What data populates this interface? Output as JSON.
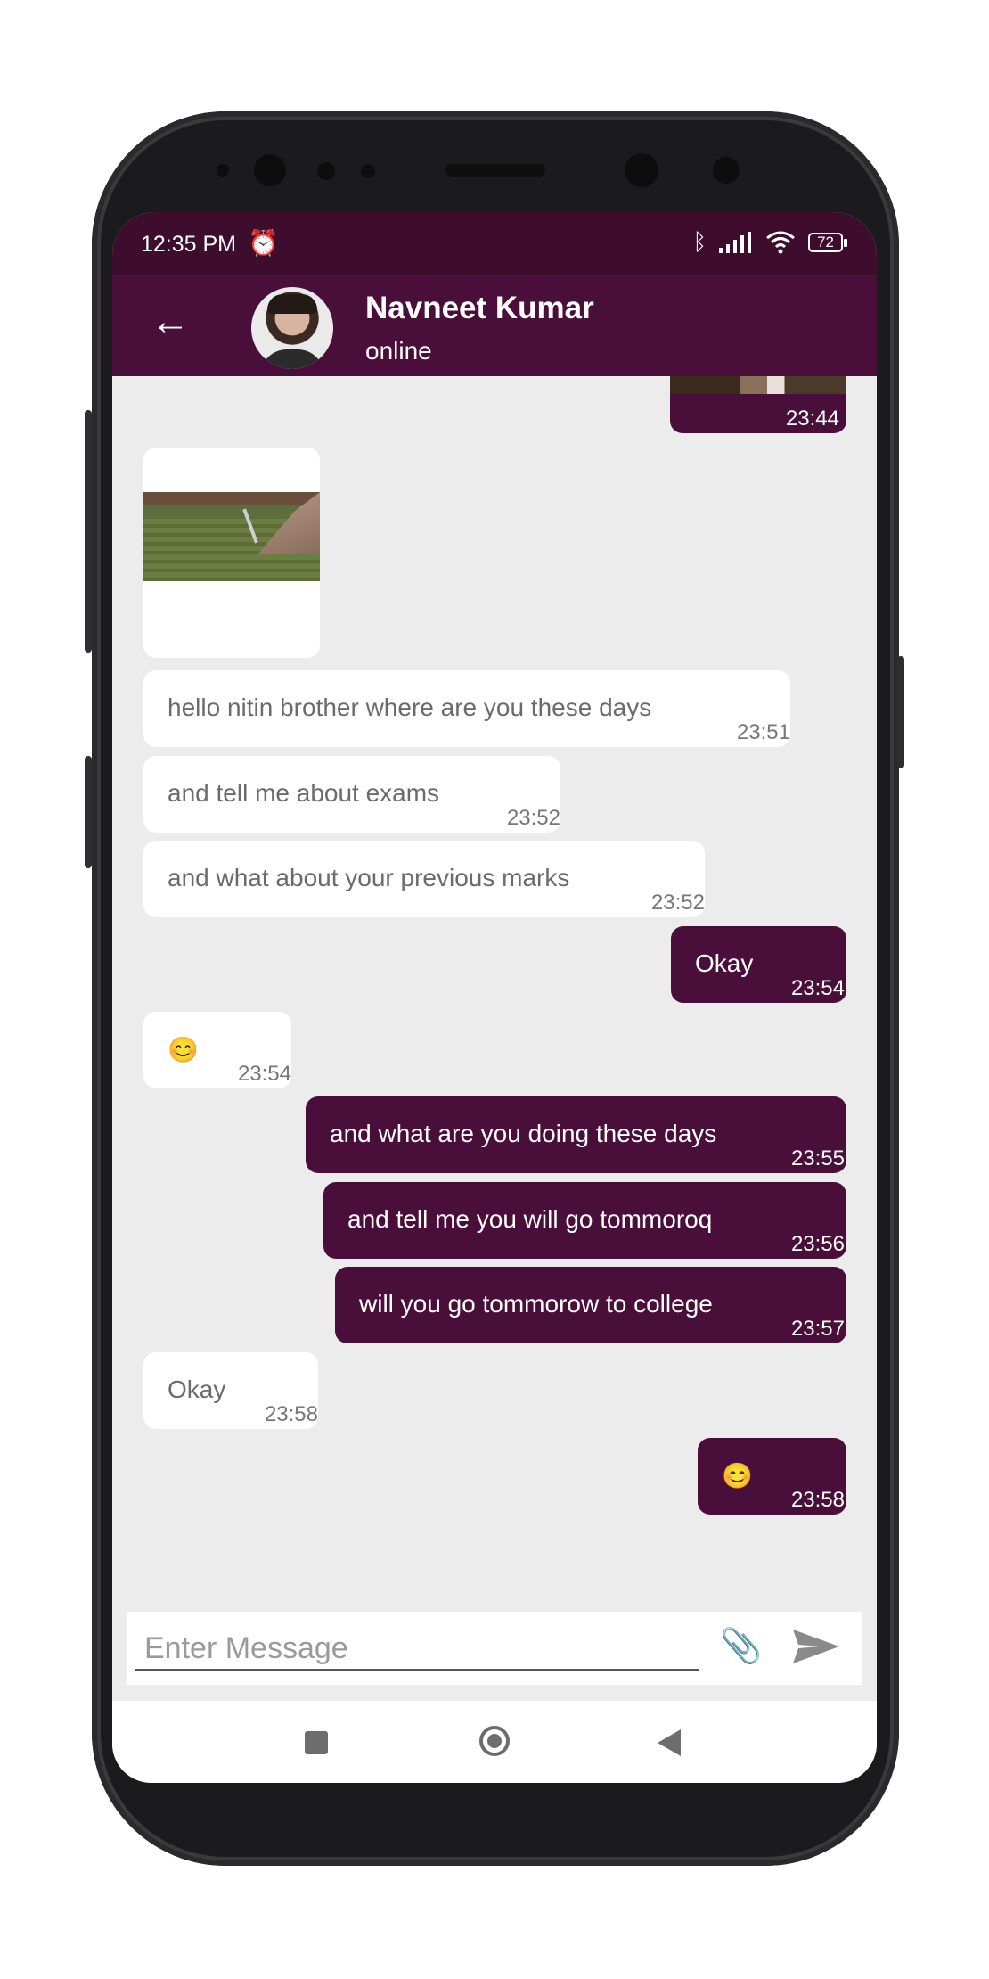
{
  "status_bar": {
    "time": "12:35 PM",
    "battery": "72"
  },
  "header": {
    "contact_name": "Navneet Kumar",
    "contact_status": "online"
  },
  "messages": [
    {
      "dir": "out",
      "type": "image",
      "time": "23:44"
    },
    {
      "dir": "in",
      "type": "image"
    },
    {
      "dir": "in",
      "text": "hello nitin brother where are you these days",
      "time": "23:51"
    },
    {
      "dir": "in",
      "text": "and tell me about exams",
      "time": "23:52"
    },
    {
      "dir": "in",
      "text": "and what about your previous marks",
      "time": "23:52"
    },
    {
      "dir": "out",
      "text": "Okay",
      "time": "23:54"
    },
    {
      "dir": "in",
      "text": "😊",
      "time": "23:54"
    },
    {
      "dir": "out",
      "text": "and what are you doing these days",
      "time": "23:55"
    },
    {
      "dir": "out",
      "text": "and tell me you will go tommoroq",
      "time": "23:56"
    },
    {
      "dir": "out",
      "text": "will you go tommorow to college",
      "time": "23:57"
    },
    {
      "dir": "in",
      "text": "Okay",
      "time": "23:58"
    },
    {
      "dir": "out",
      "text": "😊",
      "time": "23:58"
    }
  ],
  "composer": {
    "placeholder": "Enter Message"
  },
  "colors": {
    "primary": "#4a0e3b",
    "status_bar": "#3e0d2e",
    "chat_bg": "#ececec"
  },
  "icons": [
    "alarm-icon",
    "bluetooth-icon",
    "signal-icon",
    "wifi-icon",
    "battery-icon",
    "back-arrow-icon",
    "attach-icon",
    "send-icon",
    "nav-recents-icon",
    "nav-home-icon",
    "nav-back-icon"
  ]
}
